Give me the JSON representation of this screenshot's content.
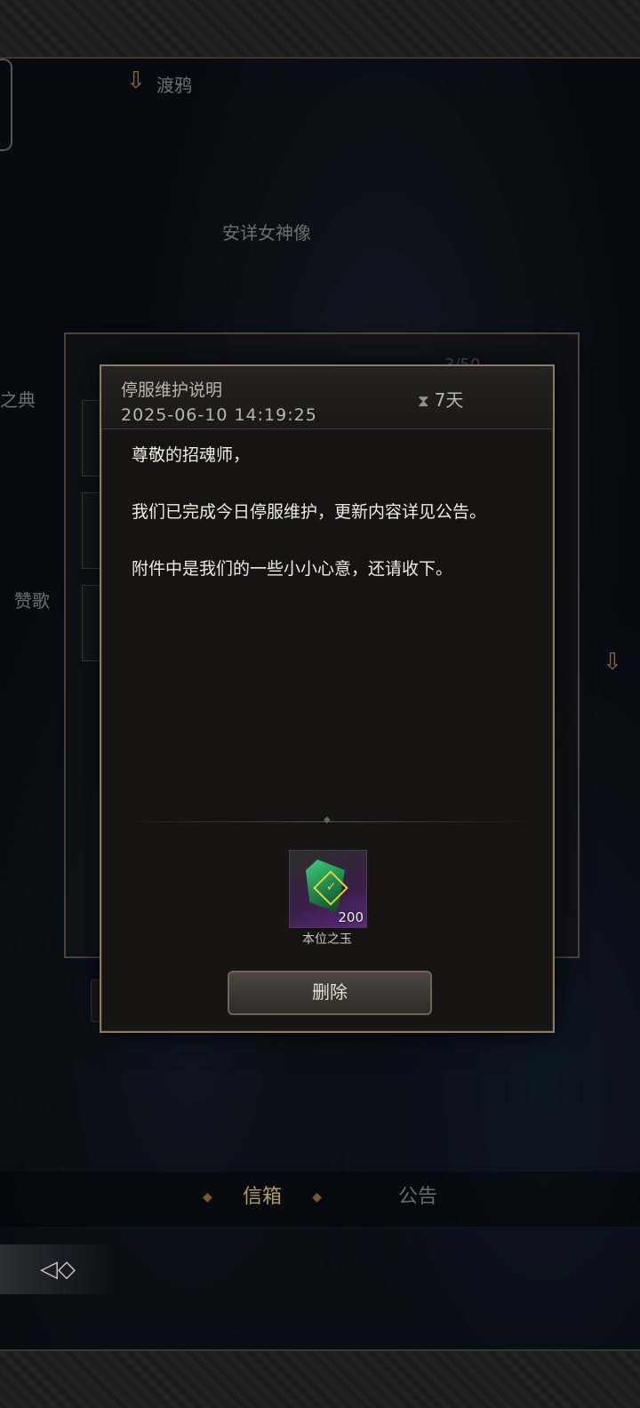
{
  "background": {
    "labels": {
      "raven": "渡鸦",
      "goddess": "安详女神像",
      "codex": "之典",
      "hymn": "赞歌",
      "count": "3/50"
    }
  },
  "dialog": {
    "title": "停服维护说明",
    "date": "2025-06-10  14:19:25",
    "expire": "7天",
    "body": {
      "greeting": "尊敬的招魂师，",
      "paragraph1": "我们已完成今日停服维护，更新内容详见公告。",
      "paragraph2": "附件中是我们的一些小小心意，还请收下。"
    },
    "attachment": {
      "name": "本位之玉",
      "quantity": "200"
    },
    "delete_label": "删除"
  },
  "tabs": {
    "mail": "信箱",
    "notice": "公告"
  },
  "icons": {
    "back": "back-arrow-icon",
    "hourglass": "hourglass-icon",
    "down_arrow": "down-arrow-icon"
  }
}
